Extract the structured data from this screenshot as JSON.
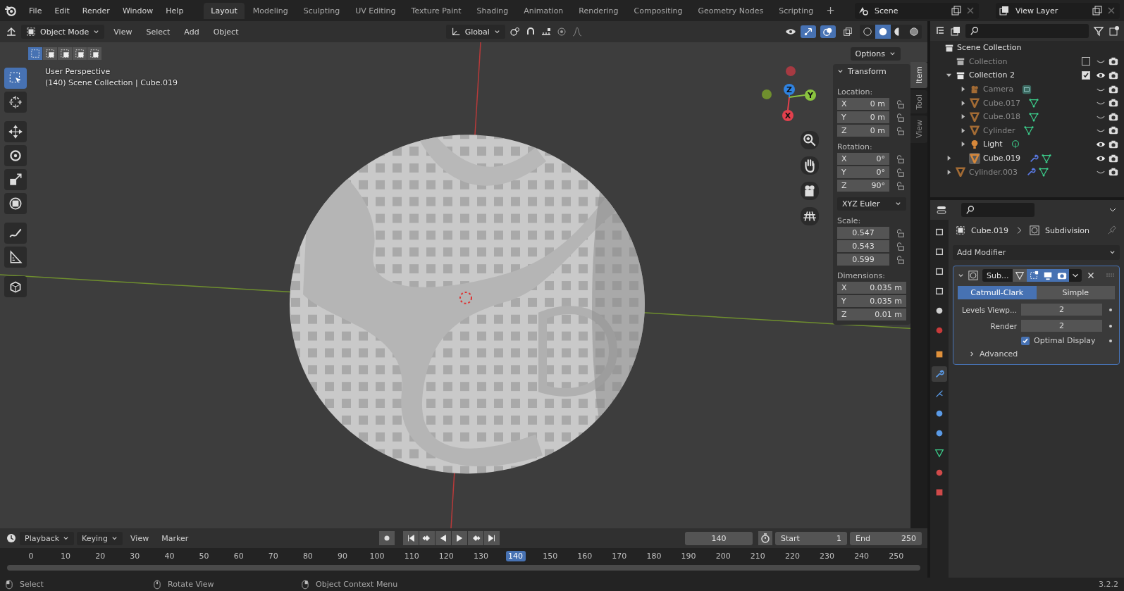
{
  "menu": [
    "File",
    "Edit",
    "Render",
    "Window",
    "Help"
  ],
  "workspaces": [
    {
      "label": "Layout",
      "selected": true
    },
    {
      "label": "Modeling",
      "selected": false
    },
    {
      "label": "Sculpting",
      "selected": false
    },
    {
      "label": "UV Editing",
      "selected": false
    },
    {
      "label": "Texture Paint",
      "selected": false
    },
    {
      "label": "Shading",
      "selected": false
    },
    {
      "label": "Animation",
      "selected": false
    },
    {
      "label": "Rendering",
      "selected": false
    },
    {
      "label": "Compositing",
      "selected": false
    },
    {
      "label": "Geometry Nodes",
      "selected": false
    },
    {
      "label": "Scripting",
      "selected": false
    }
  ],
  "add_workspace": "+",
  "scene": "Scene",
  "view_layer": "View Layer",
  "viewport_header": {
    "mode": "Object Mode",
    "menus": [
      "View",
      "Select",
      "Add",
      "Object"
    ],
    "orientation": "Global",
    "options": "Options",
    "select_modes": [
      {
        "selected": true
      },
      {
        "selected": false
      },
      {
        "selected": false
      },
      {
        "selected": false
      },
      {
        "selected": false
      }
    ],
    "toggles": [
      {
        "kind": "gizmo",
        "on": true
      },
      {
        "kind": "overlay",
        "on": true
      },
      {
        "kind": "xray",
        "on": false
      }
    ],
    "shading": [
      {
        "kind": "wireframe",
        "selected": false
      },
      {
        "kind": "solid",
        "selected": true
      },
      {
        "kind": "material",
        "selected": false
      },
      {
        "kind": "rendered",
        "selected": false
      }
    ]
  },
  "viewport": {
    "title": "User Perspective",
    "subtitle": "(140) Scene Collection | Cube.019",
    "tools": [
      {
        "kind": "select",
        "selected": true
      },
      {
        "kind": "cursor",
        "selected": false
      },
      {
        "kind": "move",
        "selected": false
      },
      {
        "kind": "rotate",
        "selected": false
      },
      {
        "kind": "scale",
        "selected": false
      },
      {
        "kind": "transform",
        "selected": false
      },
      {
        "kind": "annotate",
        "selected": false
      },
      {
        "kind": "measure",
        "selected": false
      },
      {
        "kind": "add_cube",
        "selected": false
      }
    ],
    "gizmo_axes": [
      {
        "label": "X",
        "color": "#e2404d"
      },
      {
        "label": "Y",
        "color": "#8ac33f"
      },
      {
        "label": "Z",
        "color": "#2f83e2"
      }
    ],
    "sidebar_tabs": [
      {
        "label": "Item",
        "selected": true
      },
      {
        "label": "Tool",
        "selected": false
      },
      {
        "label": "View",
        "selected": false
      }
    ],
    "transform": {
      "title": "Transform",
      "location": {
        "label": "Location:",
        "fields": [
          {
            "axis": "X",
            "value": "0 m"
          },
          {
            "axis": "Y",
            "value": "0 m"
          },
          {
            "axis": "Z",
            "value": "0 m"
          }
        ]
      },
      "rotation": {
        "label": "Rotation:",
        "fields": [
          {
            "axis": "X",
            "value": "0°"
          },
          {
            "axis": "Y",
            "value": "0°"
          },
          {
            "axis": "Z",
            "value": "90°"
          }
        ]
      },
      "rotation_mode": "XYZ Euler",
      "scale": {
        "label": "Scale:",
        "fields": [
          {
            "value": "0.547"
          },
          {
            "value": "0.543"
          },
          {
            "value": "0.599"
          }
        ]
      },
      "dimensions": {
        "label": "Dimensions:",
        "fields": [
          {
            "axis": "X",
            "value": "0.035 m"
          },
          {
            "axis": "Y",
            "value": "0.035 m"
          },
          {
            "axis": "Z",
            "value": "0.01 m"
          }
        ]
      }
    }
  },
  "outliner": {
    "root": "Scene Collection",
    "items": [
      {
        "name": "Collection",
        "kind": "collection",
        "checked": false,
        "visible": false
      },
      {
        "name": "Collection 2",
        "kind": "collection",
        "checked": true,
        "visible": true,
        "expanded": true,
        "children": [
          {
            "name": "Camera",
            "kind": "camera",
            "visible": false,
            "expanded": false,
            "modifier": false
          },
          {
            "name": "Cube.017",
            "kind": "mesh",
            "visible": false,
            "expanded": false,
            "modifier": false
          },
          {
            "name": "Cube.018",
            "kind": "mesh",
            "visible": false,
            "expanded": false,
            "modifier": false
          },
          {
            "name": "Cylinder",
            "kind": "mesh",
            "visible": false,
            "expanded": false,
            "modifier": false
          },
          {
            "name": "Light",
            "kind": "light",
            "visible": true,
            "expanded": false,
            "modifier": false
          }
        ]
      },
      {
        "name": "Cube.019",
        "kind": "mesh",
        "visible": true,
        "expanded": false,
        "modifier": true,
        "selected": true
      },
      {
        "name": "Cylinder.003",
        "kind": "mesh",
        "visible": false,
        "expanded": false,
        "modifier": true
      }
    ]
  },
  "properties": {
    "tabs": [
      {
        "kind": "tool",
        "selected": false
      },
      {
        "kind": "render",
        "selected": false
      },
      {
        "kind": "output",
        "selected": false
      },
      {
        "kind": "view_layer",
        "selected": false
      },
      {
        "kind": "scene",
        "selected": false
      },
      {
        "kind": "world",
        "selected": false
      },
      {
        "kind": "object",
        "selected": false
      },
      {
        "kind": "modifier",
        "selected": true
      },
      {
        "kind": "particles",
        "selected": false
      },
      {
        "kind": "physics",
        "selected": false
      },
      {
        "kind": "constraints",
        "selected": false
      },
      {
        "kind": "data",
        "selected": false
      },
      {
        "kind": "material",
        "selected": false
      },
      {
        "kind": "texture",
        "selected": false
      }
    ],
    "object": "Cube.019",
    "modifier_name": "Subdivision",
    "add_modifier": "Add Modifier",
    "modifier": {
      "name": "Sub...",
      "expanded": true,
      "toggles": [
        {
          "kind": "cage",
          "on": false
        },
        {
          "kind": "editmode",
          "on": true
        },
        {
          "kind": "viewport",
          "on": true
        },
        {
          "kind": "render",
          "on": true
        }
      ],
      "modes": [
        {
          "label": "Catmull-Clark",
          "selected": true
        },
        {
          "label": "Simple",
          "selected": false
        }
      ],
      "fields": [
        {
          "label": "Levels Viewp...",
          "value": "2"
        },
        {
          "label": "Render",
          "value": "2"
        }
      ],
      "optimal_display": {
        "label": "Optimal Display",
        "checked": true
      },
      "advanced": {
        "label": "Advanced",
        "expanded": false
      }
    }
  },
  "timeline": {
    "menus": [
      "Playback",
      "Keying",
      "View",
      "Marker"
    ],
    "current_frame": "140",
    "start_label": "Start",
    "start": "1",
    "end_label": "End",
    "end": "250",
    "ticks": [
      {
        "label": "0",
        "selected": false
      },
      {
        "label": "10",
        "selected": false
      },
      {
        "label": "20",
        "selected": false
      },
      {
        "label": "30",
        "selected": false
      },
      {
        "label": "40",
        "selected": false
      },
      {
        "label": "50",
        "selected": false
      },
      {
        "label": "60",
        "selected": false
      },
      {
        "label": "70",
        "selected": false
      },
      {
        "label": "80",
        "selected": false
      },
      {
        "label": "90",
        "selected": false
      },
      {
        "label": "100",
        "selected": false
      },
      {
        "label": "110",
        "selected": false
      },
      {
        "label": "120",
        "selected": false
      },
      {
        "label": "130",
        "selected": false
      },
      {
        "label": "140",
        "selected": true
      },
      {
        "label": "150",
        "selected": false
      },
      {
        "label": "160",
        "selected": false
      },
      {
        "label": "170",
        "selected": false
      },
      {
        "label": "180",
        "selected": false
      },
      {
        "label": "190",
        "selected": false
      },
      {
        "label": "200",
        "selected": false
      },
      {
        "label": "210",
        "selected": false
      },
      {
        "label": "220",
        "selected": false
      },
      {
        "label": "230",
        "selected": false
      },
      {
        "label": "240",
        "selected": false
      },
      {
        "label": "250",
        "selected": false
      }
    ]
  },
  "status_bar": {
    "hints": [
      "Select",
      "Rotate View",
      "Object Context Menu"
    ],
    "version": "3.2.2"
  }
}
